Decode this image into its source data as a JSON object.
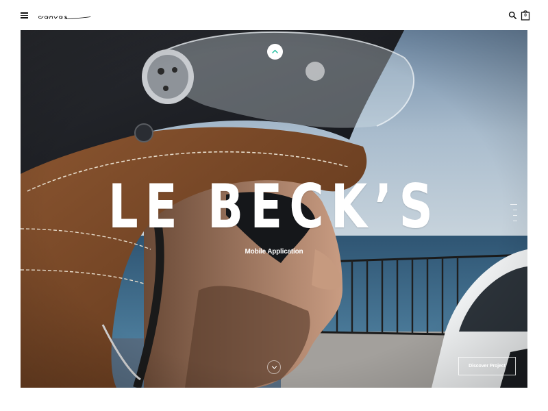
{
  "header": {
    "logo_text": "canvas",
    "menu_icon": "hamburger-menu-icon",
    "search_icon": "search-icon",
    "cart_icon": "shopping-bag-icon",
    "cart_count": "0"
  },
  "hero": {
    "title": "LE BECK’S",
    "subtitle": "Mobile Application",
    "cta_label": "Discover Project",
    "scroll_up_icon": "chevron-up-icon",
    "scroll_down_icon": "chevron-down-icon",
    "accent_color": "#1abc9c",
    "slide_count": 4,
    "active_slide": 1
  }
}
